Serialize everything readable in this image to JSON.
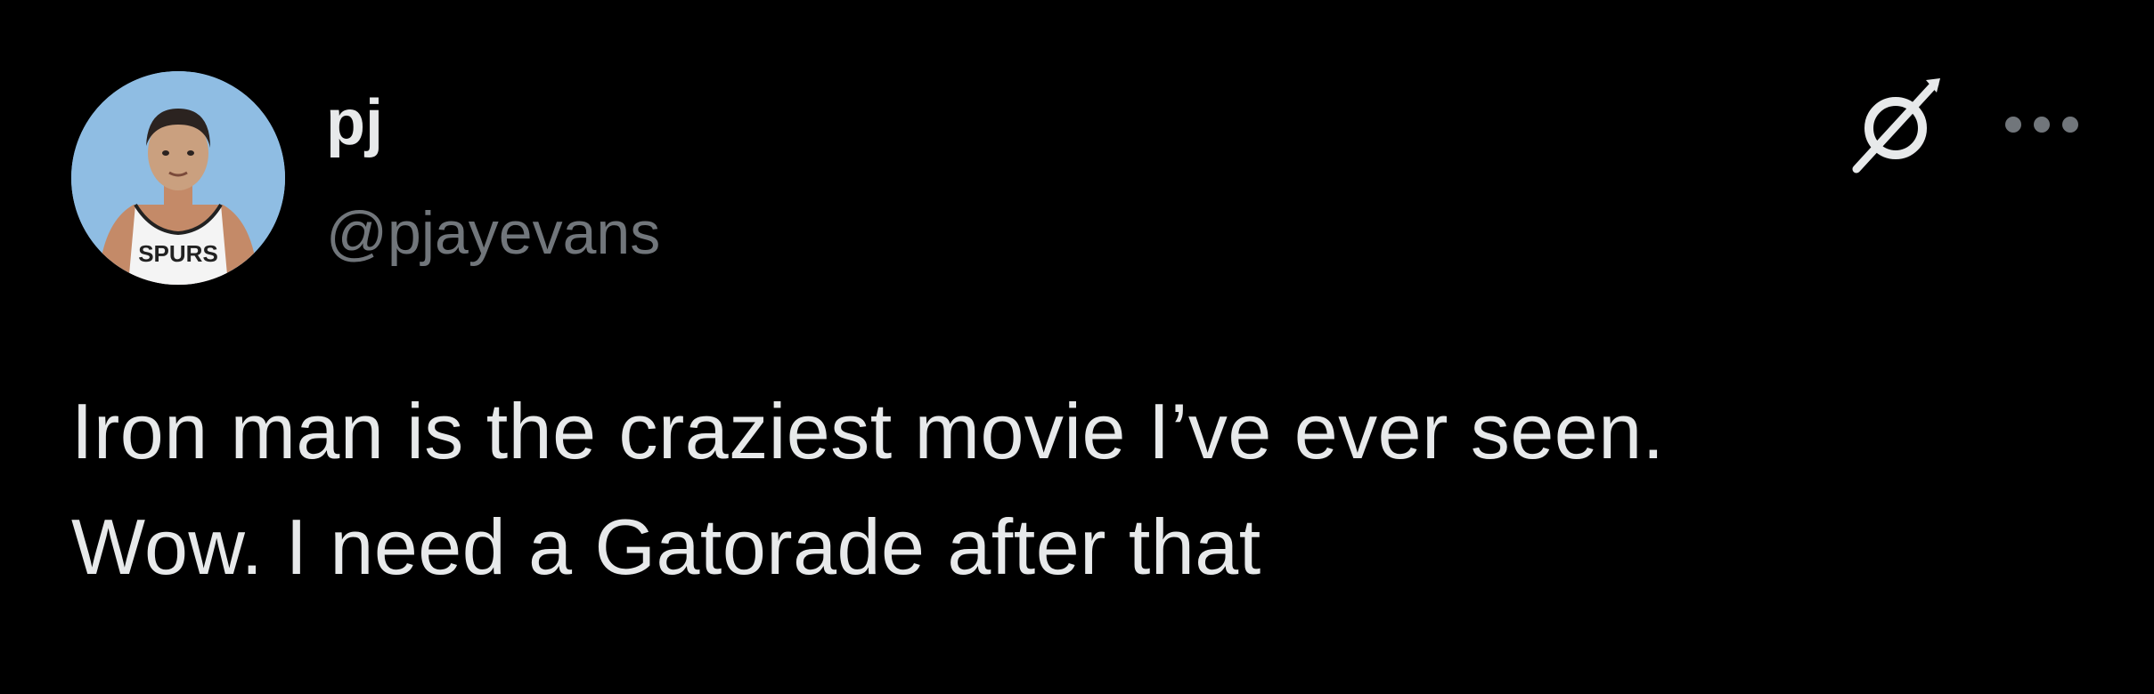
{
  "author": {
    "display_name": "pj",
    "handle": "@pjayevans",
    "avatar": {
      "icon": "avatar-basketball-player",
      "jersey_text": "SPURS",
      "background_color": "#8fbde3"
    }
  },
  "actions": {
    "grok_icon": "grok-icon",
    "more_icon": "more-dots-icon"
  },
  "tweet": {
    "lines": [
      "Iron man is the craziest movie I’ve ever seen.",
      "Wow. I need a Gatorade after that"
    ]
  },
  "colors": {
    "background": "#000000",
    "primary_text": "#e7e9ea",
    "secondary_text": "#71767b"
  }
}
